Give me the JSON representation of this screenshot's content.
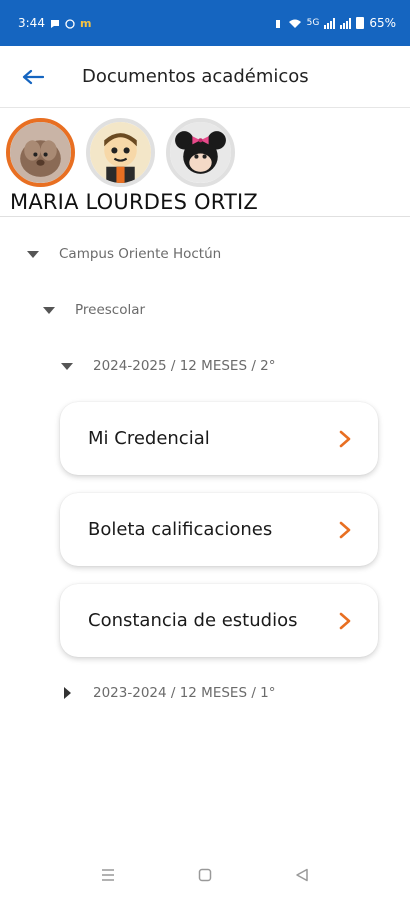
{
  "status_bar": {
    "time": "3:44",
    "network": "5G",
    "battery": "65%",
    "background": "#1565c0"
  },
  "app_bar": {
    "title": "Documentos académicos"
  },
  "student": {
    "name": "MARIA LOURDES ORTIZ",
    "avatars": [
      {
        "icon": "dog-plush-avatar",
        "selected": true
      },
      {
        "icon": "cartoon-kid-avatar",
        "selected": false
      },
      {
        "icon": "minnie-mouse-avatar",
        "selected": false
      }
    ]
  },
  "tree": {
    "campus": "Campus Oriente Hoctún",
    "level": "Preescolar",
    "period_current": "2024-2025 / 12 MESES / 2°",
    "period_previous": "2023-2024 / 12 MESES / 1°"
  },
  "documents": [
    {
      "label": "Mi Credencial"
    },
    {
      "label": "Boleta calificaciones"
    },
    {
      "label": "Constancia de estudios"
    }
  ],
  "colors": {
    "accent": "#e86f22",
    "primary": "#1565c0"
  }
}
